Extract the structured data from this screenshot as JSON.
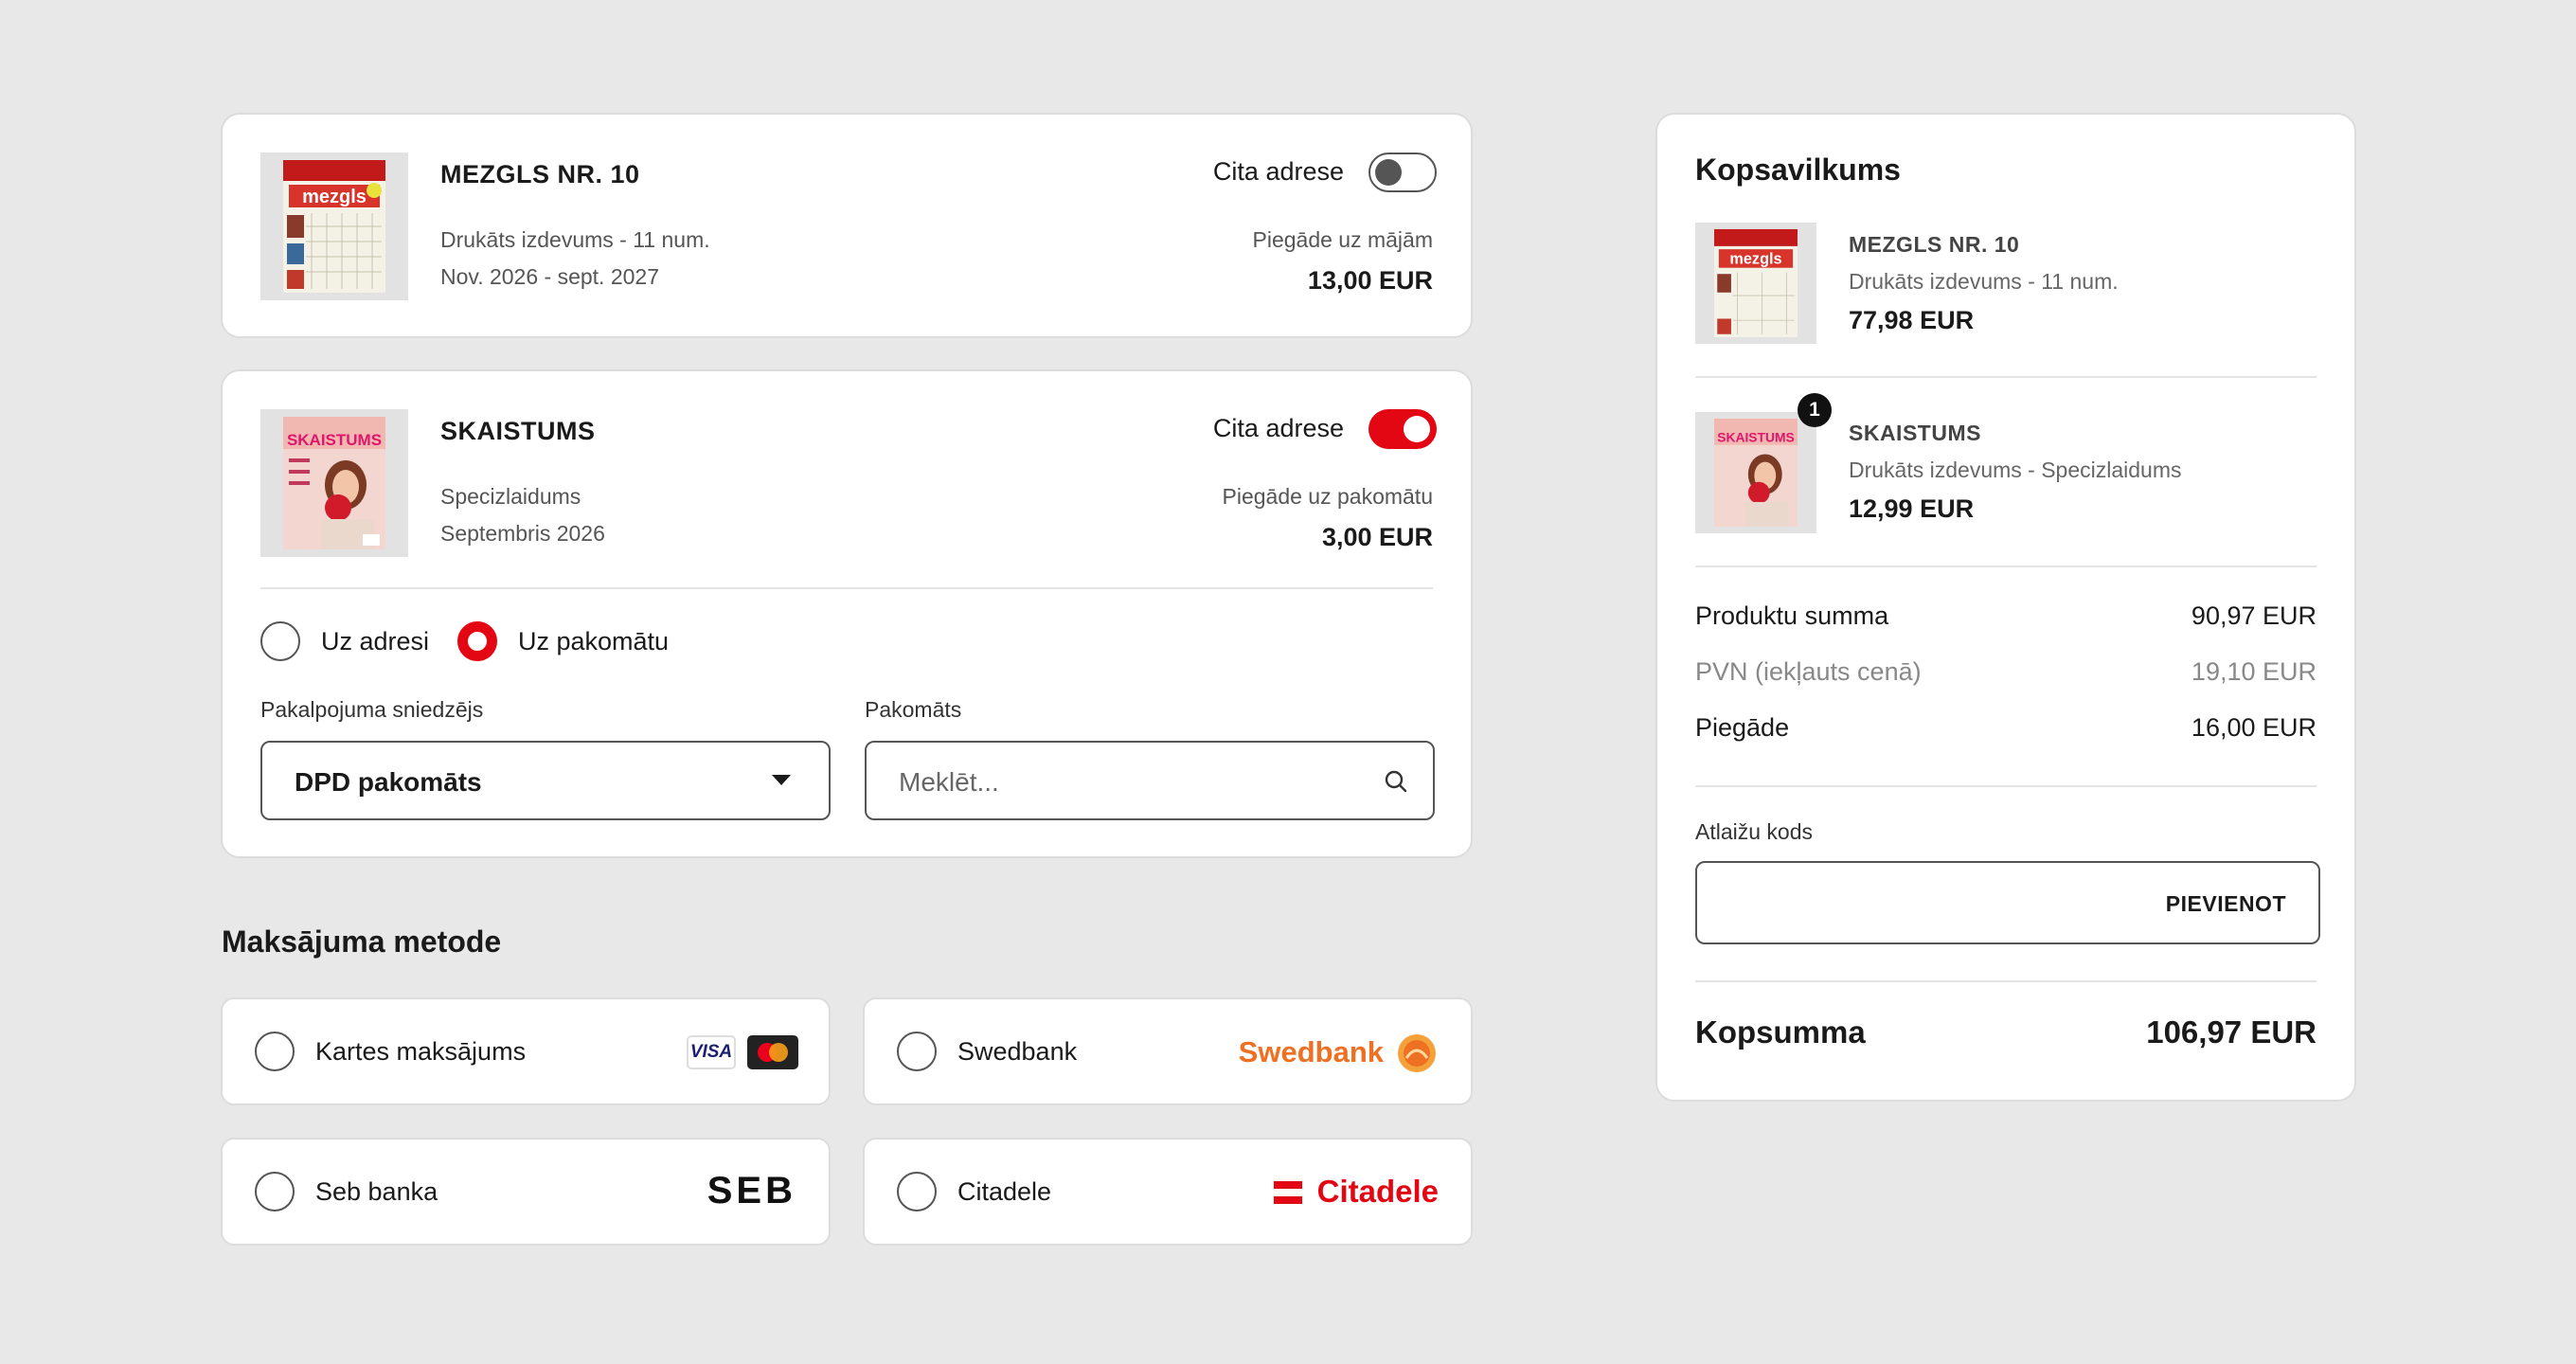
{
  "items": [
    {
      "title": "MEZGLS NR. 10",
      "edition": "Drukāts izdevums - 11 num.",
      "period": "Nov. 2026 - sept. 2027",
      "toggle_label": "Cita adrese",
      "toggle_on": false,
      "delivery": "Piegāde uz mājām",
      "price": "13,00 EUR",
      "cover_text": "mezgls"
    },
    {
      "title": "SKAISTUMS",
      "edition": "Specizlaidums",
      "period": "Septembris 2026",
      "toggle_label": "Cita adrese",
      "toggle_on": true,
      "delivery": "Piegāde uz pakomātu",
      "price": "3,00 EUR",
      "cover_text": "SKAISTUMS"
    }
  ],
  "delivery_options": {
    "address_label": "Uz adresi",
    "parcel_label": "Uz pakomātu",
    "selected": "parcel",
    "provider_label": "Pakalpojuma sniedzējs",
    "provider_value": "DPD pakomāts",
    "locker_label": "Pakomāts",
    "locker_placeholder": "Meklēt..."
  },
  "payment": {
    "heading": "Maksājuma metode",
    "methods": [
      {
        "label": "Kartes maksājums",
        "logo": "visa-mastercard"
      },
      {
        "label": "Swedbank",
        "logo": "Swedbank"
      },
      {
        "label": "Seb banka",
        "logo": "SEB"
      },
      {
        "label": "Citadele",
        "logo": "Citadele"
      }
    ]
  },
  "summary": {
    "heading": "Kopsavilkums",
    "items": [
      {
        "title": "MEZGLS NR. 10",
        "edition": "Drukāts izdevums - 11 num.",
        "price": "77,98 EUR",
        "badge": ""
      },
      {
        "title": "SKAISTUMS",
        "edition": "Drukāts izdevums - Specizlaidums",
        "price": "12,99 EUR",
        "badge": "1"
      }
    ],
    "products_label": "Produktu summa",
    "products_value": "90,97 EUR",
    "vat_label": "PVN (iekļauts cenā)",
    "vat_value": "19,10 EUR",
    "delivery_label": "Piegāde",
    "delivery_value": "16,00 EUR",
    "discount_label": "Atlaižu kods",
    "discount_button": "PIEVIENOT",
    "total_label": "Kopsumma",
    "total_value": "106,97 EUR"
  },
  "colors": {
    "accent": "#e30613",
    "background": "#e8e8e8",
    "swedbank": "#ee7023",
    "citadele": "#e30613"
  }
}
